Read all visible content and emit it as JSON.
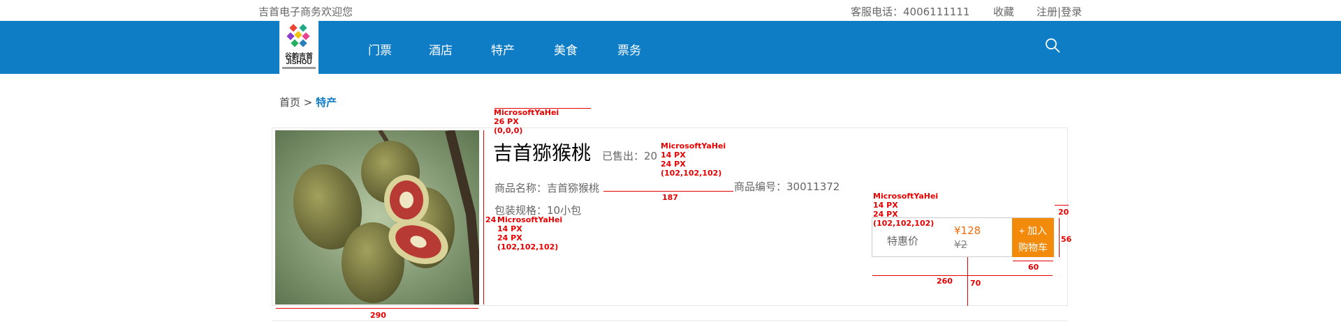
{
  "topbar": {
    "welcome": "吉首电子商务欢迎您",
    "service": "客服电话：4006111111",
    "favorite": "收藏",
    "register": "注册",
    "separator": "|",
    "login": "登录"
  },
  "logo": {
    "cn": "谷韵吉首",
    "en": "JISHOU"
  },
  "nav": {
    "items": [
      "门票",
      "酒店",
      "特产",
      "美食",
      "票务"
    ],
    "search_icon": "search-icon"
  },
  "breadcrumb": {
    "home": "首页",
    "sep": ">",
    "current": "特产"
  },
  "product": {
    "title": "吉首猕猴桃",
    "sold": "已售出：20",
    "name": "商品名称：吉首猕猴桃",
    "code": "商品编号：30011372",
    "spec": "包装规格：10小包",
    "deal_label": "特惠价",
    "price_now": "¥128",
    "price_old": "¥2",
    "cart_line1": "+ 加入",
    "cart_line2": "购物车"
  },
  "annotations": {
    "title_font": "MicrosoftYaHei\n26 PX\n(0,0,0)",
    "info_font": "MicrosoftYaHei\n14 PX\n24 PX\n(102,102,102)",
    "spec_font": "MicrosoftYaHei\n14 PX\n24 PX\n(102,102,102)",
    "price_font": "MicrosoftYaHei\n14 PX\n24 PX\n(102,102,102)",
    "dim_187": "187",
    "dim_290": "290",
    "dim_24": "24",
    "dim_20": "20",
    "dim_56": "56",
    "dim_60": "60",
    "dim_260": "260",
    "dim_70": "70"
  },
  "colors": {
    "nav": "#0f7cc6",
    "accent_orange": "#f28a0c",
    "price": "#f26b0a",
    "annotation": "#e60000"
  }
}
